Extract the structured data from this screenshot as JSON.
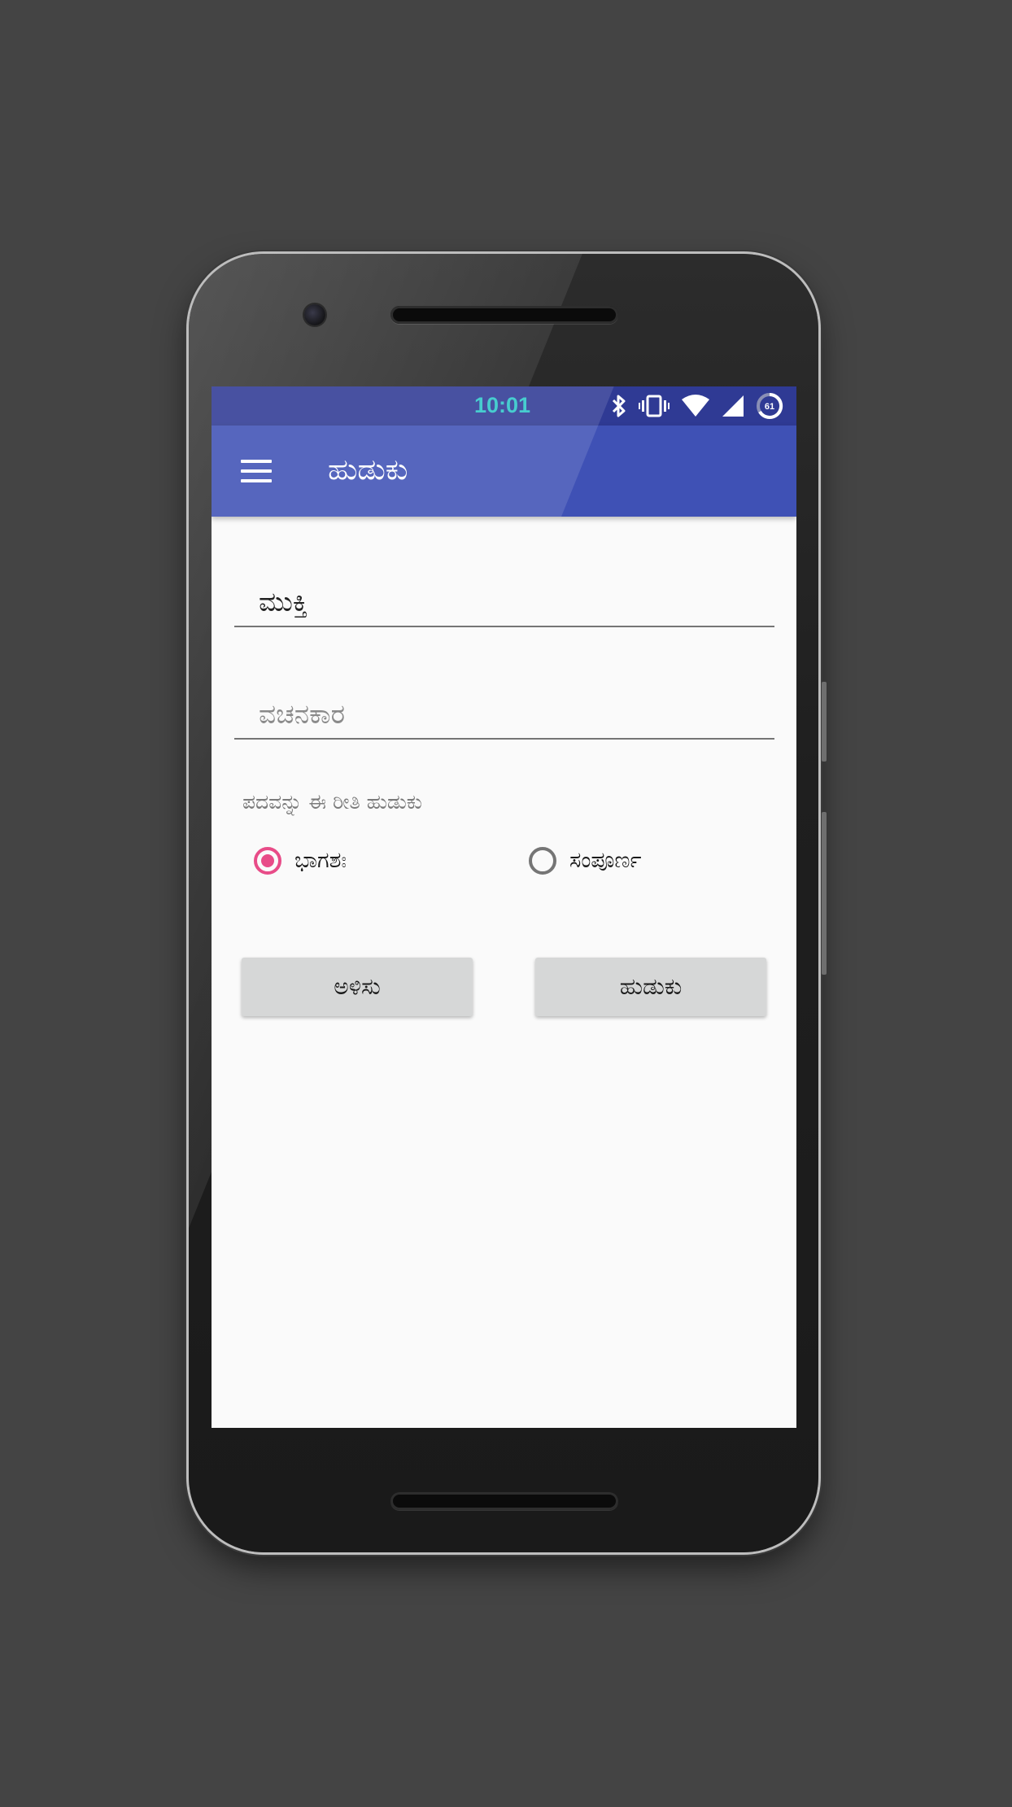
{
  "status_bar": {
    "time": "10:01",
    "battery_level": "61",
    "icons": [
      "bluetooth-icon",
      "vibrate-icon",
      "wifi-icon",
      "cell-signal-icon",
      "battery-icon"
    ]
  },
  "app_bar": {
    "title": "ಹುಡುಕು",
    "menu_icon": "hamburger-menu-icon"
  },
  "form": {
    "keyword_field": {
      "value": "ಮುಕ್ತಿ",
      "placeholder": ""
    },
    "author_field": {
      "value": "",
      "placeholder": "ವಚನಕಾರ"
    },
    "search_mode_label": "ಪದವನ್ನು ಈ ರೀತಿ ಹುಡುಕು",
    "options": [
      {
        "label": "ಭಾಗಶಃ",
        "selected": true
      },
      {
        "label": "ಸಂಪೂರ್ಣ",
        "selected": false
      }
    ]
  },
  "buttons": {
    "clear_label": "ಅಳಿಸು",
    "search_label": "ಹುಡುಕು"
  },
  "colors": {
    "app_bar": "#3f51b5",
    "status_bar": "#2f3a94",
    "accent": "#e84c88",
    "background": "#444444"
  }
}
